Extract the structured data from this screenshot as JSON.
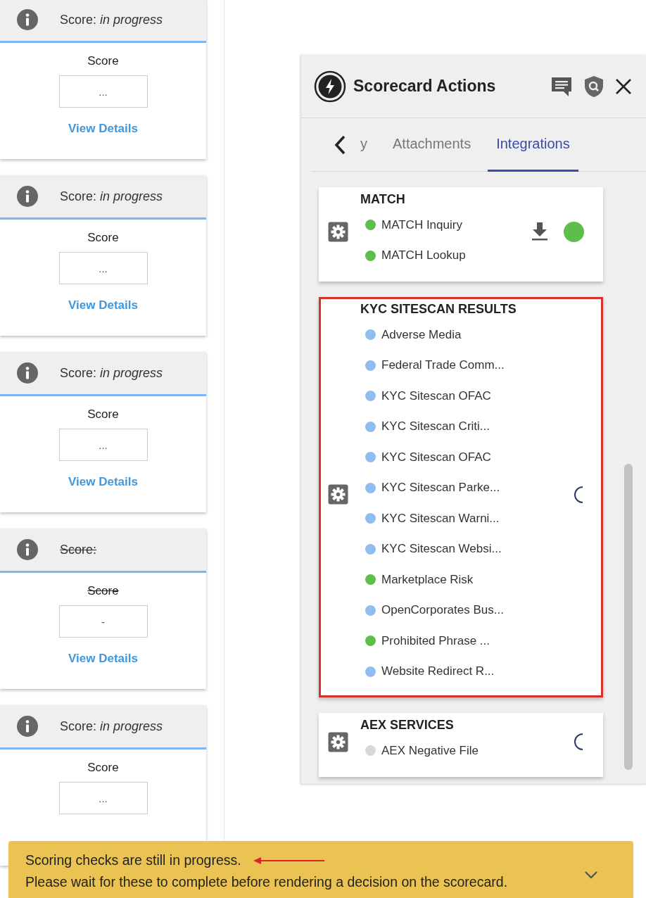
{
  "cards": [
    {
      "status": "Score: *in progress*",
      "struck": false,
      "label": "Score",
      "value": "...",
      "link": "View Details"
    },
    {
      "status": "Score: *in progress*",
      "struck": false,
      "label": "Score",
      "value": "...",
      "link": "View Details"
    },
    {
      "status": "Score: *in progress*",
      "struck": false,
      "label": "Score",
      "value": "...",
      "link": "View Details"
    },
    {
      "status": "Score:",
      "struck": true,
      "label": "Score",
      "value": "-",
      "link": "View Details"
    },
    {
      "status": "Score: *in progress*",
      "struck": false,
      "label": "Score",
      "value": "..."
    }
  ],
  "panel": {
    "title": "Scorecard Actions",
    "tabs": [
      {
        "label": "y",
        "selected": false
      },
      {
        "label": "Attachments",
        "selected": false
      },
      {
        "label": "Integrations",
        "selected": true
      }
    ],
    "groups": [
      {
        "title": "MATCH",
        "highlighted": false,
        "kind": "done",
        "items": [
          {
            "label": "MATCH Inquiry",
            "color": "#5cbf4a"
          },
          {
            "label": "MATCH Lookup",
            "color": "#5cbf4a"
          }
        ]
      },
      {
        "title": "KYC SITESCAN RESULTS",
        "highlighted": true,
        "kind": "loading",
        "items": [
          {
            "label": "Adverse Media",
            "color": "#90bdf0"
          },
          {
            "label": "Federal Trade Comm...",
            "color": "#90bdf0"
          },
          {
            "label": "KYC Sitescan OFAC",
            "color": "#90bdf0"
          },
          {
            "label": "KYC Sitescan Criti...",
            "color": "#90bdf0"
          },
          {
            "label": "KYC Sitescan OFAC",
            "color": "#90bdf0"
          },
          {
            "label": "KYC Sitescan Parke...",
            "color": "#90bdf0"
          },
          {
            "label": "KYC Sitescan Warni...",
            "color": "#90bdf0"
          },
          {
            "label": "KYC Sitescan Websi...",
            "color": "#90bdf0"
          },
          {
            "label": "Marketplace Risk",
            "color": "#5cbf4a"
          },
          {
            "label": "OpenCorporates Bus...",
            "color": "#90bdf0"
          },
          {
            "label": "Prohibited Phrase ...",
            "color": "#5cbf4a"
          },
          {
            "label": "Website Redirect R...",
            "color": "#90bdf0"
          }
        ]
      },
      {
        "title": "AEX SERVICES",
        "highlighted": false,
        "kind": "loading",
        "items": [
          {
            "label": "AEX Negative File",
            "color": "#d8d8d8"
          }
        ]
      }
    ]
  },
  "banner": {
    "lines": [
      "Scoring checks are still in progress.",
      "Please wait for these to complete before rendering a decision on the scorecard."
    ]
  }
}
